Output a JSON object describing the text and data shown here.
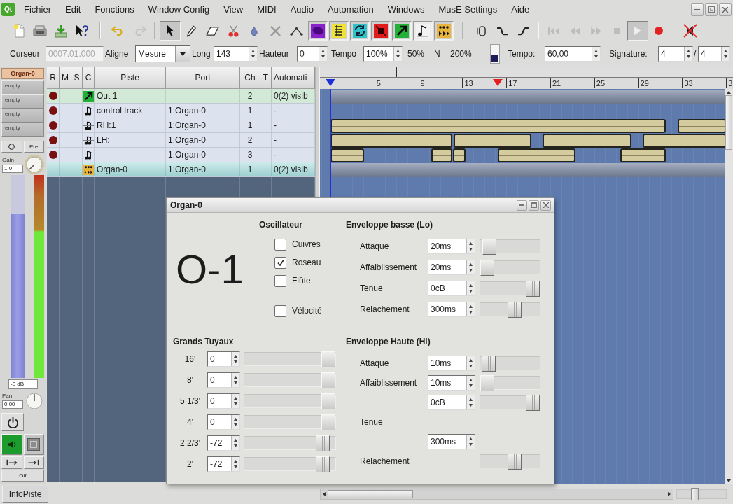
{
  "logo": "Qt",
  "menu": [
    "Fichier",
    "Edit",
    "Fonctions",
    "Window Config",
    "View",
    "MIDI",
    "Audio",
    "Automation",
    "Windows",
    "MusE Settings",
    "Aide"
  ],
  "toolbar": {
    "edit": [
      {
        "kind": "undo",
        "disabled": false
      },
      {
        "kind": "redo",
        "disabled": true
      }
    ],
    "tools": [
      {
        "kind": "pointer",
        "selected": true
      },
      {
        "kind": "pencil",
        "selected": false
      },
      {
        "kind": "eraser",
        "selected": false
      },
      {
        "kind": "scissors",
        "selected": false
      },
      {
        "kind": "glue",
        "selected": false
      },
      {
        "kind": "cross",
        "selected": false
      },
      {
        "kind": "line",
        "selected": false
      }
    ],
    "transport": [
      {
        "kind": "start",
        "disabled": true,
        "pressed": false
      },
      {
        "kind": "rewind",
        "disabled": true,
        "pressed": false
      },
      {
        "kind": "forward",
        "disabled": true,
        "pressed": false
      },
      {
        "kind": "stop",
        "disabled": true,
        "pressed": false
      },
      {
        "kind": "play",
        "disabled": true,
        "pressed": true
      },
      {
        "kind": "record",
        "disabled": false,
        "pressed": false
      }
    ]
  },
  "position_bar": {
    "cursor": {
      "label": "Curseur",
      "value": "0007.01.000",
      "disabled": true
    },
    "snap": {
      "label": "Aligne",
      "value": "Mesure"
    },
    "length": {
      "label": "Long",
      "value": "143"
    },
    "pitch": {
      "label": "Hauteur",
      "value": "0"
    },
    "tempo_scale": {
      "label": "Tempo",
      "value": "100%"
    },
    "tempo_presets": [
      "50%",
      "N",
      "200%"
    ],
    "tempo": {
      "label": "Tempo:",
      "value": "60,00"
    },
    "signature": {
      "label": "Signature:",
      "numerator": "4",
      "separator": "/",
      "denominator": "4"
    }
  },
  "track_info": {
    "name": "Organ-0",
    "inserts": [
      "empty",
      "empty",
      "empty",
      "empty"
    ],
    "pre_button": "Pre",
    "gain": {
      "label": "Gain",
      "value": "1.0"
    },
    "fader": {
      "level": 0.81
    },
    "meter": {
      "level": 1
    },
    "volume": "-0 dB",
    "pan": {
      "label": "Pan",
      "value": "0.00"
    },
    "sound_on": true,
    "automation_mode": "Off"
  },
  "track_list": {
    "columns": [
      "R",
      "M",
      "S",
      "C",
      "Piste",
      "Port",
      "Ch",
      "T",
      "Automati"
    ],
    "rows": [
      {
        "kind": "output",
        "record_button": true,
        "name": "Out 1",
        "channel": "2",
        "automation": "0(2) visib",
        "selected": false
      },
      {
        "kind": "midi",
        "record_button": true,
        "name": "control track",
        "port": "1:Organ-0",
        "channel": "1",
        "automation": "-",
        "selected": false
      },
      {
        "kind": "midi",
        "record_button": true,
        "name": "RH:1",
        "port": "1:Organ-0",
        "channel": "1",
        "automation": "-",
        "selected": false
      },
      {
        "kind": "midi",
        "record_button": true,
        "name": "LH:",
        "port": "1:Organ-0",
        "channel": "2",
        "automation": "-",
        "selected": false
      },
      {
        "kind": "midi",
        "record_button": true,
        "port": "1:Organ-0",
        "channel": "3",
        "automation": "-",
        "selected": false
      },
      {
        "kind": "synth",
        "record_button": false,
        "name": "Organ-0",
        "port": "1:Organ-0",
        "channel": "1",
        "automation": "0(2) visib",
        "selected": true
      }
    ]
  },
  "arranger": {
    "ruler": [
      "5",
      "9",
      "13",
      "17",
      "21",
      "25",
      "29",
      "33",
      "3"
    ]
  },
  "bottom_bar": {
    "info_button": "InfoPiste"
  },
  "synth_window": {
    "title": "Organ-0",
    "model": "O-1",
    "oscillator": {
      "title": "Oscillateur",
      "options": [
        {
          "label": "Cuivres",
          "checked": false
        },
        {
          "label": "Roseau",
          "checked": true
        },
        {
          "label": "Flûte",
          "checked": false
        }
      ],
      "velocity": {
        "label": "Vélocité",
        "checked": false
      }
    },
    "envelope_lo": {
      "title": "Enveloppe basse (Lo)",
      "rows": [
        {
          "label": "Attaque",
          "value": "20ms",
          "level": 0.05
        },
        {
          "label": "Affaiblissement",
          "value": "20ms",
          "level": 0
        },
        {
          "label": "Tenue",
          "value": "0cB",
          "level": 1
        },
        {
          "label": "Relachement",
          "value": "300ms",
          "level": 0.6
        }
      ]
    },
    "drawbars": {
      "title": "Grands Tuyaux",
      "rows": [
        {
          "label": "16'",
          "value": "0",
          "level": 1
        },
        {
          "label": "8'",
          "value": "0",
          "level": 1
        },
        {
          "label": "5 1/3'",
          "value": "0",
          "level": 1
        },
        {
          "label": "4'",
          "value": "0",
          "level": 1
        },
        {
          "label": "2 2/3'",
          "value": "-72",
          "level": 0.93
        },
        {
          "label": "2'",
          "value": "-72",
          "level": 0.93
        }
      ]
    },
    "envelope_hi": {
      "title": "Enveloppe Haute (Hi)",
      "rows": [
        {
          "label": "Attaque",
          "value": "10ms",
          "level": 0.03
        },
        {
          "label": "Affaiblissement",
          "value": "10ms",
          "level": 0
        },
        {
          "value": "0cB",
          "level": 1
        },
        {
          "label": "Tenue"
        },
        {
          "value": "300ms"
        },
        {
          "label": "Relachement",
          "level": 0.6
        }
      ]
    }
  }
}
